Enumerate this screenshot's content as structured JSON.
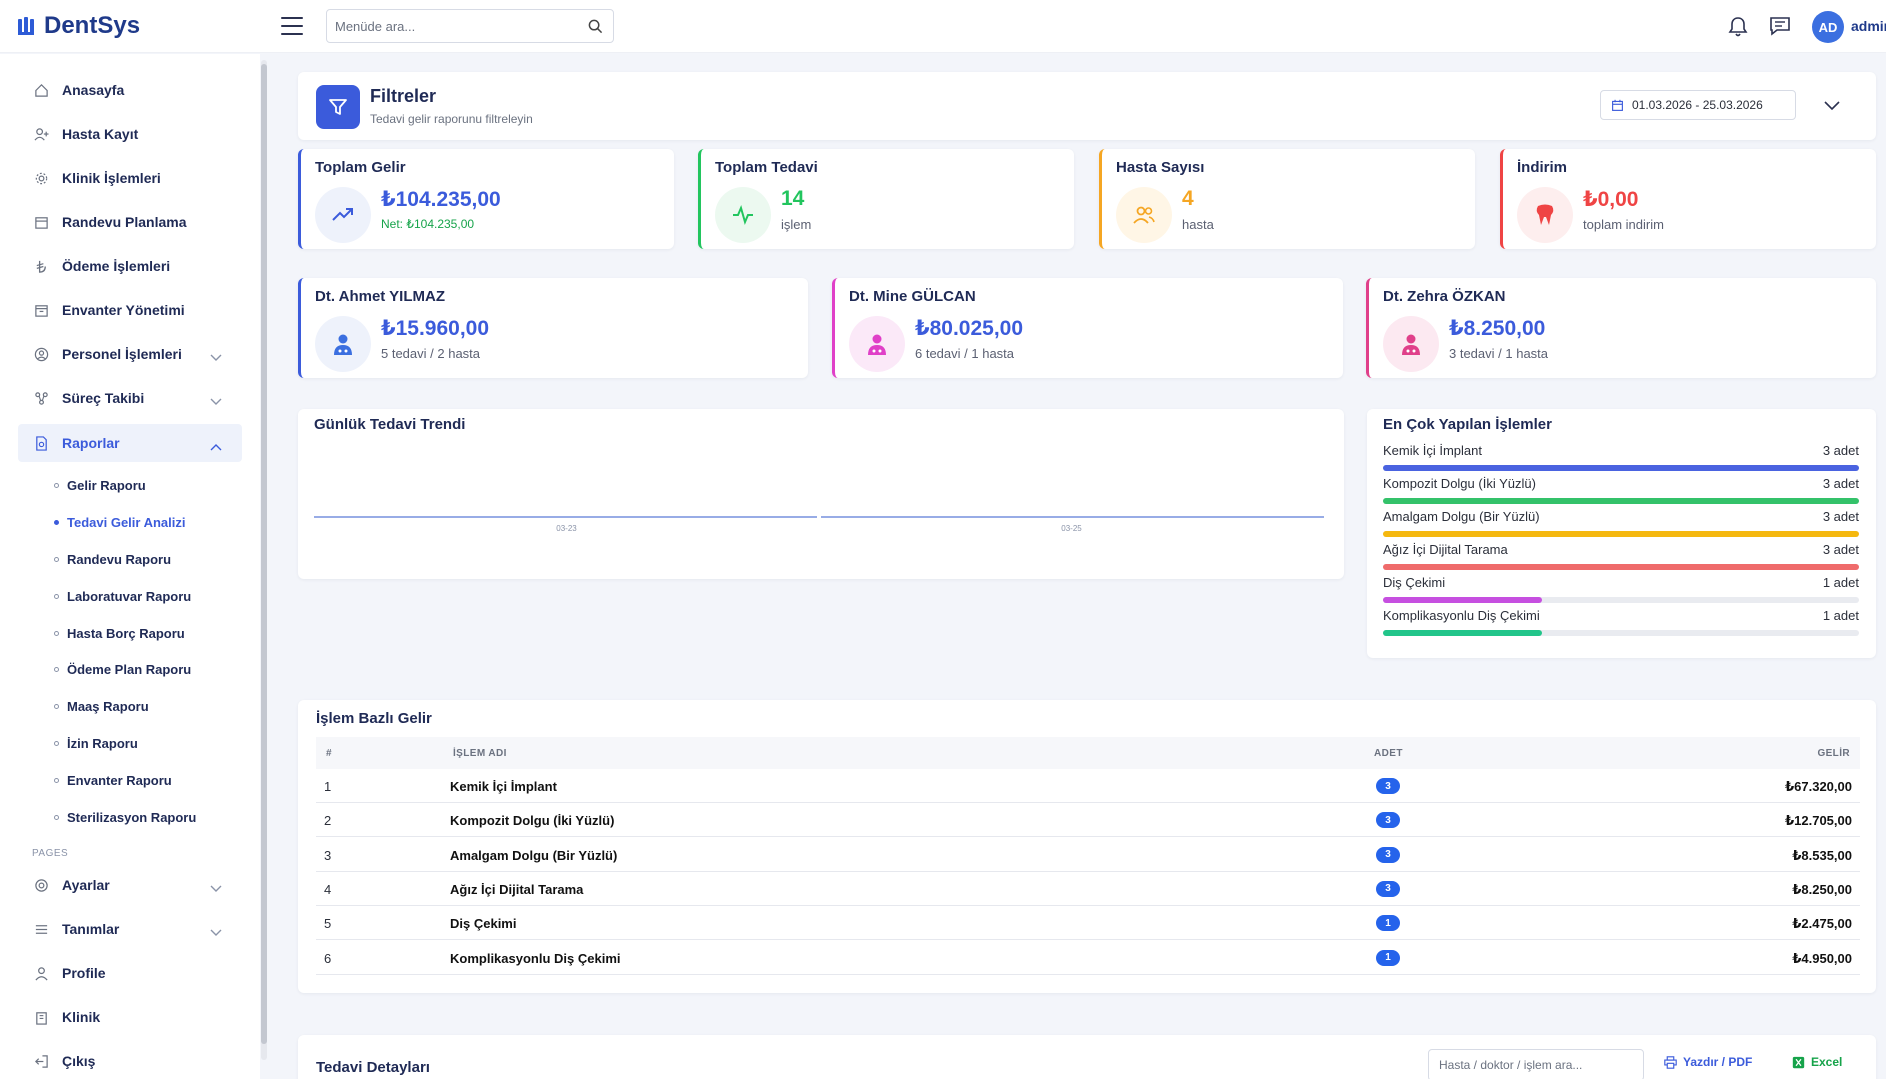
{
  "app": {
    "name": "DentSys"
  },
  "header": {
    "search_placeholder": "Menüde ara...",
    "avatar_initials": "AD",
    "username": "admin"
  },
  "sidebar": {
    "items": [
      {
        "label": "Anasayfa",
        "icon": "home-icon"
      },
      {
        "label": "Hasta Kayıt",
        "icon": "user-add-icon"
      },
      {
        "label": "Klinik İşlemleri",
        "icon": "settings-icon"
      },
      {
        "label": "Randevu Planlama",
        "icon": "calendar-icon"
      },
      {
        "label": "Ödeme İşlemleri",
        "icon": "lira-icon"
      },
      {
        "label": "Envanter Yönetimi",
        "icon": "inventory-icon"
      },
      {
        "label": "Personel İşlemleri",
        "icon": "person-circle-icon"
      },
      {
        "label": "Süreç Takibi",
        "icon": "process-icon"
      },
      {
        "label": "Raporlar",
        "icon": "report-icon"
      }
    ],
    "report_subitems": [
      "Gelir Raporu",
      "Tedavi Gelir Analizi",
      "Randevu Raporu",
      "Laboratuvar Raporu",
      "Hasta Borç Raporu",
      "Ödeme Plan Raporu",
      "Maaş Raporu",
      "İzin Raporu",
      "Envanter Raporu",
      "Sterilizasyon Raporu"
    ],
    "section_label": "PAGES",
    "pages": [
      {
        "label": "Ayarlar",
        "icon": "gear-icon"
      },
      {
        "label": "Tanımlar",
        "icon": "list-icon"
      },
      {
        "label": "Profile",
        "icon": "user-icon"
      },
      {
        "label": "Klinik",
        "icon": "building-icon"
      },
      {
        "label": "Çıkış",
        "icon": "logout-icon"
      }
    ]
  },
  "filters": {
    "title": "Filtreler",
    "subtitle": "Tedavi gelir raporunu filtreleyin",
    "date_range": "01.03.2026 - 25.03.2026"
  },
  "stats": {
    "total_income": {
      "title": "Toplam Gelir",
      "value": "₺104.235,00",
      "sub": "Net: ₺104.235,00",
      "color": "#3b5bdb"
    },
    "total_treatment": {
      "title": "Toplam Tedavi",
      "value": "14",
      "sub": "işlem",
      "color": "#22c55e"
    },
    "patient_count": {
      "title": "Hasta Sayısı",
      "value": "4",
      "sub": "hasta",
      "color": "#f5a623"
    },
    "discount": {
      "title": "İndirim",
      "value": "₺0,00",
      "sub": "toplam indirim",
      "color": "#ef4444"
    }
  },
  "doctors": [
    {
      "name": "Dt. Ahmet YILMAZ",
      "value": "₺15.960,00",
      "sub": "5 tedavi / 2 hasta",
      "color": "#3b5bdb"
    },
    {
      "name": "Dt. Mine GÜLCAN",
      "value": "₺80.025,00",
      "sub": "6 tedavi / 1 hasta",
      "color": "#e040c8"
    },
    {
      "name": "Dt. Zehra ÖZKAN",
      "value": "₺8.250,00",
      "sub": "3 tedavi / 1 hasta",
      "color": "#e0408a"
    }
  ],
  "trend": {
    "title": "Günlük Tedavi Trendi"
  },
  "chart_data": {
    "type": "line",
    "x": [
      "03-23",
      "03-25"
    ]
  },
  "top_ops": {
    "title": "En Çok Yapılan İşlemler",
    "items": [
      {
        "name": "Kemik İçi İmplant",
        "count": "3 adet",
        "fraction": 1.0,
        "color": "#4a63e0"
      },
      {
        "name": "Kompozit Dolgu (İki Yüzlü)",
        "count": "3 adet",
        "fraction": 1.0,
        "color": "#34c26a"
      },
      {
        "name": "Amalgam Dolgu (Bir Yüzlü)",
        "count": "3 adet",
        "fraction": 1.0,
        "color": "#f5b80f"
      },
      {
        "name": "Ağız İçi Dijital Tarama",
        "count": "3 adet",
        "fraction": 1.0,
        "color": "#ef6b6b"
      },
      {
        "name": "Diş Çekimi",
        "count": "1 adet",
        "fraction": 0.333,
        "color": "#c64fe0"
      },
      {
        "name": "Komplikasyonlu Diş Çekimi",
        "count": "1 adet",
        "fraction": 0.333,
        "color": "#22c58a"
      }
    ]
  },
  "op_table": {
    "title": "İşlem Bazlı Gelir",
    "headers": {
      "no": "#",
      "name": "İŞLEM ADI",
      "count": "ADET",
      "income": "GELİR"
    },
    "rows": [
      {
        "no": "1",
        "name": "Kemik İçi İmplant",
        "count": "3",
        "income": "₺67.320,00"
      },
      {
        "no": "2",
        "name": "Kompozit Dolgu (İki Yüzlü)",
        "count": "3",
        "income": "₺12.705,00"
      },
      {
        "no": "3",
        "name": "Amalgam Dolgu (Bir Yüzlü)",
        "count": "3",
        "income": "₺8.535,00"
      },
      {
        "no": "4",
        "name": "Ağız İçi Dijital Tarama",
        "count": "3",
        "income": "₺8.250,00"
      },
      {
        "no": "5",
        "name": "Diş Çekimi",
        "count": "1",
        "income": "₺2.475,00"
      },
      {
        "no": "6",
        "name": "Komplikasyonlu Diş Çekimi",
        "count": "1",
        "income": "₺4.950,00"
      }
    ]
  },
  "details": {
    "title": "Tedavi Detayları",
    "search_placeholder": "Hasta / doktor / işlem ara...",
    "print_label": "Yazdır / PDF",
    "excel_label": "Excel"
  }
}
